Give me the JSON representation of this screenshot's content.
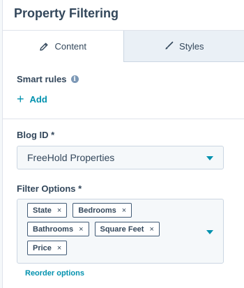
{
  "header": {
    "title": "Property Filtering"
  },
  "tabs": [
    {
      "label": "Content",
      "icon": "pencil-icon",
      "active": true
    },
    {
      "label": "Styles",
      "icon": "brush-icon",
      "active": false
    }
  ],
  "smart_rules": {
    "label": "Smart rules",
    "info_icon": "i",
    "add_label": "Add"
  },
  "blog_id": {
    "label": "Blog ID *",
    "value": "FreeHold Properties"
  },
  "filter_options": {
    "label": "Filter Options *",
    "tags": [
      "State",
      "Bedrooms",
      "Bathrooms",
      "Square Feet",
      "Price"
    ],
    "remove_glyph": "×",
    "reorder_label": "Reorder options"
  },
  "colors": {
    "accent": "#0091ae",
    "text": "#33475b",
    "border": "#cbd6e2"
  }
}
